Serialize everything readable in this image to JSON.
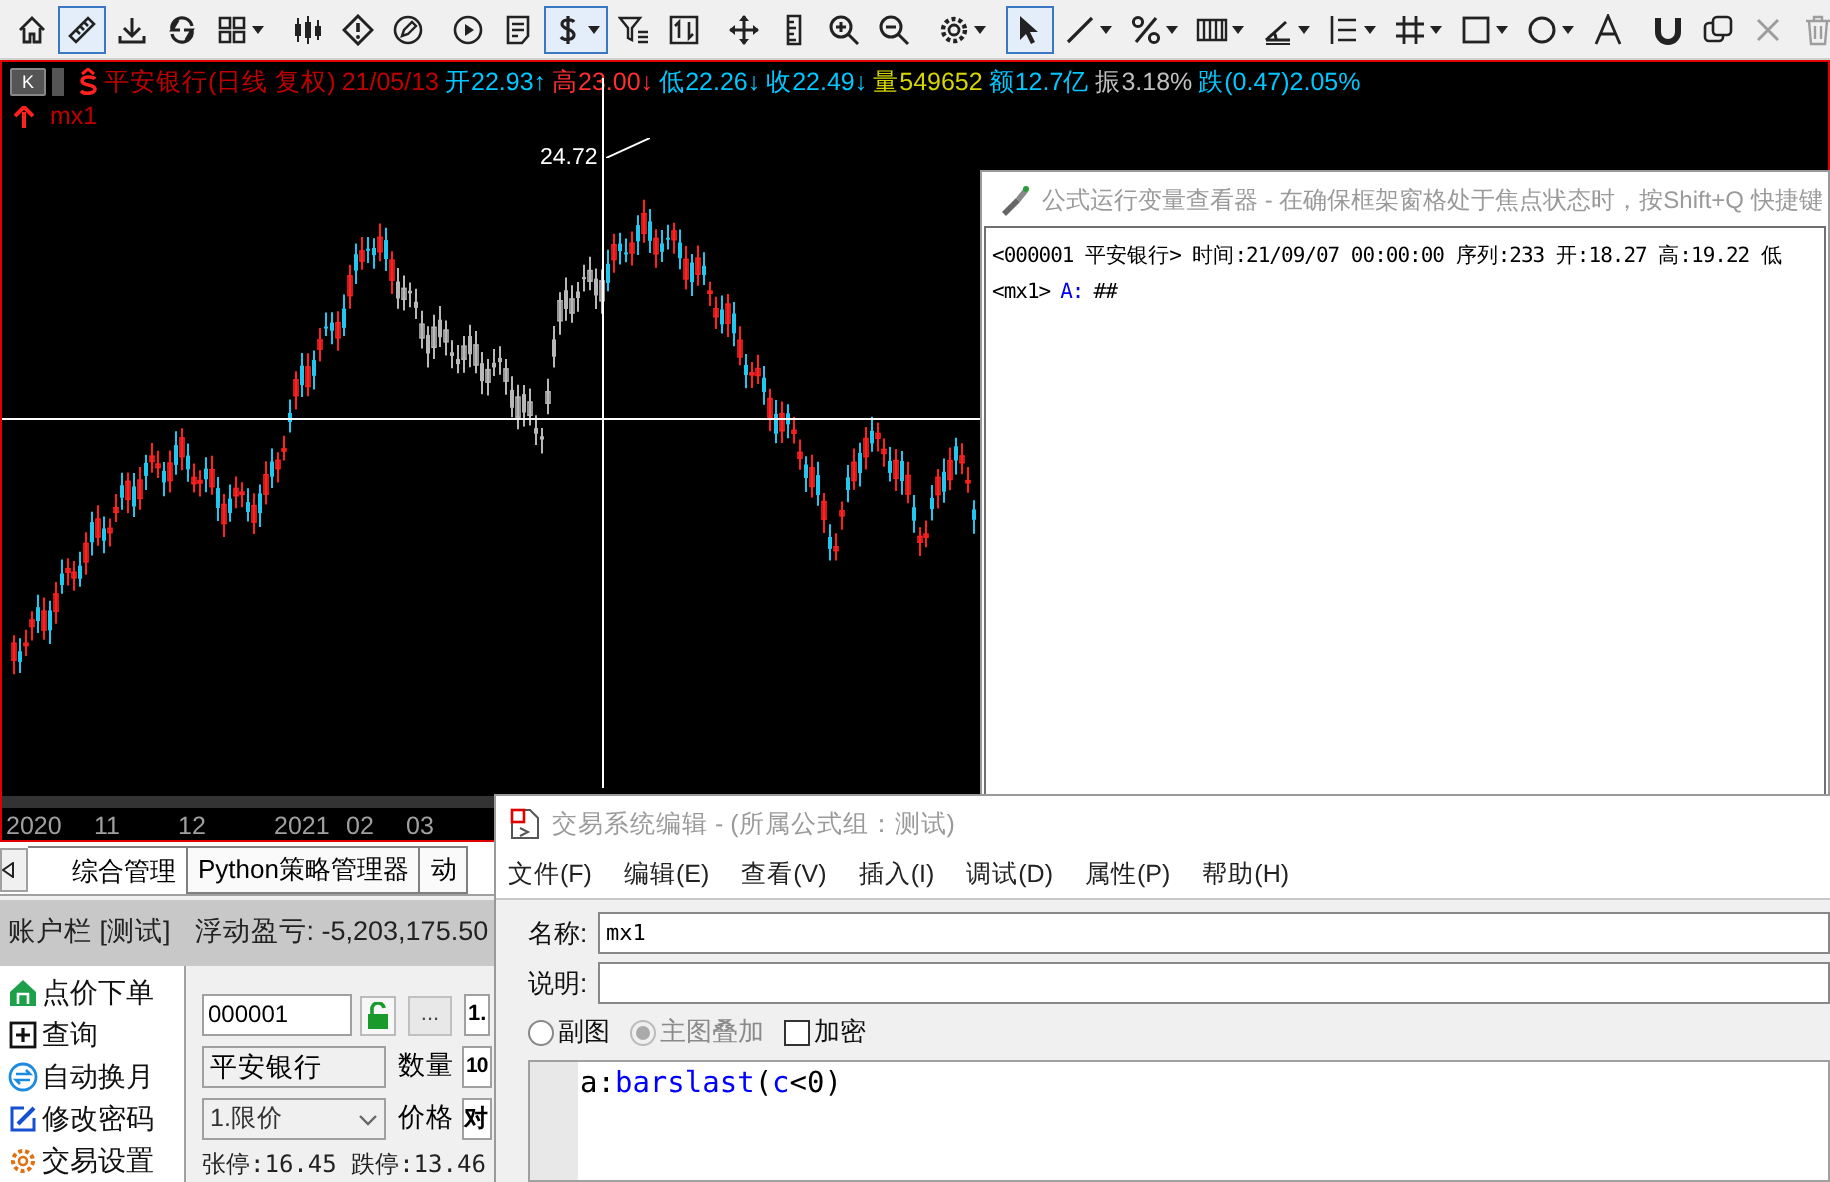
{
  "toolbar": [
    {
      "kind": "home",
      "selected": false,
      "menu": false
    },
    {
      "kind": "ruler",
      "selected": true,
      "menu": false
    },
    {
      "kind": "download",
      "selected": false,
      "menu": false
    },
    {
      "kind": "swirl",
      "selected": false,
      "menu": false
    },
    {
      "kind": "grid",
      "selected": false,
      "menu": true
    },
    {
      "kind": "sep"
    },
    {
      "kind": "candles",
      "selected": false,
      "menu": false
    },
    {
      "kind": "warning",
      "selected": false,
      "menu": false
    },
    {
      "kind": "edit",
      "selected": false,
      "menu": false
    },
    {
      "kind": "sep"
    },
    {
      "kind": "play",
      "selected": false,
      "menu": false
    },
    {
      "kind": "doc",
      "selected": false,
      "menu": false
    },
    {
      "kind": "dollar",
      "selected": true,
      "menu": true
    },
    {
      "kind": "filter",
      "selected": false,
      "menu": false
    },
    {
      "kind": "updown",
      "selected": false,
      "menu": false
    },
    {
      "kind": "sep"
    },
    {
      "kind": "move",
      "selected": false,
      "menu": false
    },
    {
      "kind": "vruler",
      "selected": false,
      "menu": false
    },
    {
      "kind": "zoomin",
      "selected": false,
      "menu": false
    },
    {
      "kind": "zoomout",
      "selected": false,
      "menu": false
    },
    {
      "kind": "sep"
    },
    {
      "kind": "gear",
      "selected": false,
      "menu": true
    },
    {
      "kind": "sep"
    },
    {
      "kind": "cursor",
      "selected": true,
      "menu": false
    },
    {
      "kind": "line",
      "selected": false,
      "menu": true
    },
    {
      "kind": "percent",
      "selected": false,
      "menu": true
    },
    {
      "kind": "bars",
      "selected": false,
      "menu": true
    },
    {
      "kind": "angle",
      "selected": false,
      "menu": true
    },
    {
      "kind": "list",
      "selected": false,
      "menu": true
    },
    {
      "kind": "hash",
      "selected": false,
      "menu": true
    },
    {
      "kind": "rect",
      "selected": false,
      "menu": true
    },
    {
      "kind": "circle",
      "selected": false,
      "menu": true
    },
    {
      "kind": "text",
      "selected": false,
      "menu": false
    },
    {
      "kind": "sep"
    },
    {
      "kind": "magnet",
      "selected": false,
      "menu": false
    },
    {
      "kind": "copy",
      "selected": false,
      "menu": false
    },
    {
      "kind": "close",
      "selected": false,
      "menu": false,
      "disabled": true
    },
    {
      "kind": "trash",
      "selected": false,
      "menu": false,
      "disabled": true
    }
  ],
  "chart": {
    "k_button": "K",
    "header": [
      {
        "text": "平安银行(日线 复权)",
        "color": "#c00000"
      },
      {
        "text": "21/05/13",
        "color": "#c00000"
      },
      {
        "text": "开22.93↑",
        "color": "#00c8ff"
      },
      {
        "text": "高23.00↓",
        "color": "#ff3030"
      },
      {
        "text": "低22.26↓",
        "color": "#00c8ff"
      },
      {
        "text": "收22.49↓",
        "color": "#00c8ff"
      },
      {
        "text": "量549652",
        "color": "#d6d600"
      },
      {
        "text": "额12.7亿",
        "color": "#00c8ff"
      },
      {
        "text": "振3.18%",
        "color": "#c0c0c0"
      },
      {
        "text": "跌(0.47)2.05%",
        "color": "#00c8ff"
      }
    ],
    "indicator": "mx1",
    "price_label": "24.72",
    "axis_labels": [
      "2020",
      "11",
      "12",
      "2021",
      "02",
      "03"
    ]
  },
  "viewer": {
    "title": "公式运行变量查看器 - 在确保框架窗格处于焦点状态时，按Shift+Q 快捷键",
    "line_1": "<000001 平安银行> 时间:21/09/07 00:00:00 序列:233 开:18.27 高:19.22 低",
    "line_2_prefix": "<mx1>",
    "line_2_var": "A:",
    "line_2_value": "##"
  },
  "tabs": [
    {
      "label": "综合管理",
      "selected": true
    },
    {
      "label": "Python策略管理器",
      "selected": false
    },
    {
      "label": "动",
      "selected": false
    }
  ],
  "account_bar": {
    "title": "账户栏 [测试]",
    "pnl": "浮动盈亏: -5,203,175.50"
  },
  "side_menu": [
    {
      "kind": "order",
      "label": "点价下单"
    },
    {
      "kind": "query",
      "label": "查询"
    },
    {
      "kind": "roll",
      "label": "自动换月"
    },
    {
      "kind": "password",
      "label": "修改密码"
    },
    {
      "kind": "settings",
      "label": "交易设置"
    }
  ],
  "order_form": {
    "code": "000001",
    "more": "...",
    "account": "1.",
    "name": "平安银行",
    "qty_label": "数量",
    "qty": "10",
    "type": "1.限价",
    "price_label": "价格",
    "price": "对",
    "limits": "张停:16.45 跌停:13.46"
  },
  "editor": {
    "title": "交易系统编辑 - (所属公式组：测试)",
    "menu": [
      "文件(F)",
      "编辑(E)",
      "查看(V)",
      "插入(I)",
      "调试(D)",
      "属性(P)",
      "帮助(H)"
    ],
    "name_label": "名称:",
    "name": "mx1",
    "desc_label": "说明:",
    "options": [
      {
        "kind": "radio",
        "label": "副图",
        "checked": false,
        "disabled": false
      },
      {
        "kind": "radio",
        "label": "主图叠加",
        "checked": true,
        "disabled": true
      },
      {
        "kind": "checkbox",
        "label": "加密",
        "checked": false,
        "disabled": false
      }
    ],
    "code": [
      {
        "text": "a:",
        "color": "#000000"
      },
      {
        "text": "barslast",
        "color": "#0000ff"
      },
      {
        "text": "(",
        "color": "#000000"
      },
      {
        "text": "c",
        "color": "#0000ff"
      },
      {
        "text": "<0)",
        "color": "#000000"
      }
    ]
  }
}
